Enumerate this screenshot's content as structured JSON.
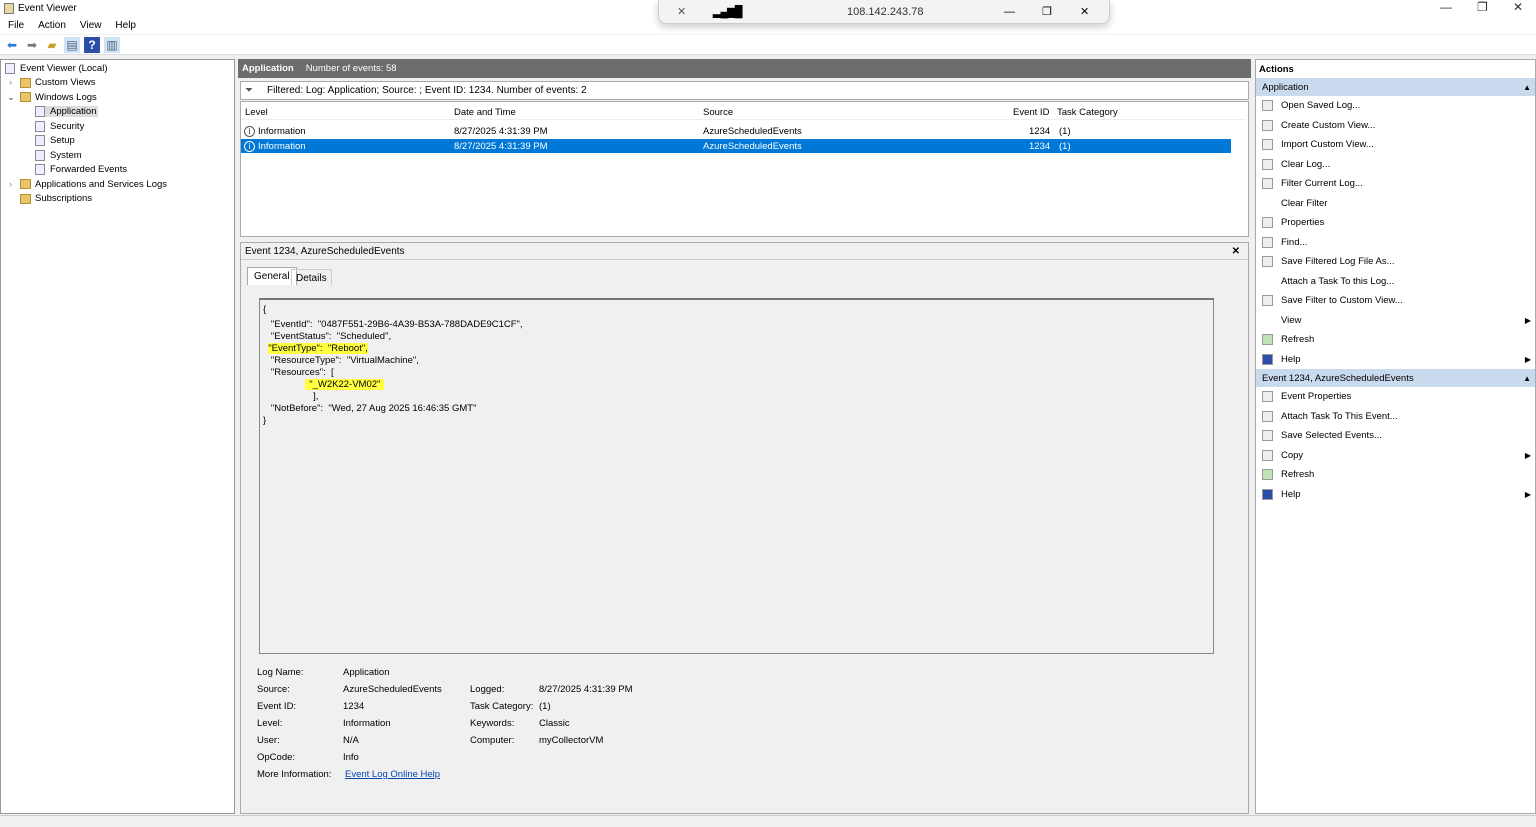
{
  "window": {
    "title": "Event Viewer",
    "minimize": "—",
    "maximize": "❐",
    "close": "✕"
  },
  "rdp": {
    "address": "108.142.243.78",
    "minimize": "—",
    "restore": "❐",
    "close": "✕"
  },
  "menu": [
    "File",
    "Action",
    "View",
    "Help"
  ],
  "tree": {
    "root": "Event Viewer (Local)",
    "custom_views": "Custom Views",
    "windows_logs": "Windows Logs",
    "logs": [
      "Application",
      "Security",
      "Setup",
      "System",
      "Forwarded Events"
    ],
    "app_services": "Applications and Services Logs",
    "subscriptions": "Subscriptions"
  },
  "center": {
    "title": "Application",
    "count": "Number of events: 58",
    "filter": "Filtered: Log: Application; Source: ; Event ID: 1234. Number of events: 2",
    "columns": [
      "Level",
      "Date and Time",
      "Source",
      "Event ID",
      "Task Category"
    ],
    "rows": [
      {
        "level": "Information",
        "date": "8/27/2025 4:31:39 PM",
        "source": "AzureScheduledEvents",
        "id": "1234",
        "task": "(1)"
      },
      {
        "level": "Information",
        "date": "8/27/2025 4:31:39 PM",
        "source": "AzureScheduledEvents",
        "id": "1234",
        "task": "(1)"
      }
    ]
  },
  "detail": {
    "title": "Event 1234, AzureScheduledEvents",
    "close": "✕",
    "tabs": [
      "General",
      "Details"
    ],
    "json": {
      "l0": "{",
      "l1": "   \"EventId\":  \"0487F551-29B6-4A39-B53A-788DADE9C1CF\",",
      "l2": "   \"EventStatus\":  \"Scheduled\",",
      "l3": "\"EventType\":  \"Reboot\",",
      "l4": "   \"ResourceType\":  \"VirtualMachine\",",
      "l5": "   \"Resources\":  [",
      "l6": "\"_W2K22-VM02\"",
      "l7": "                   ],",
      "l8": "   \"NotBefore\":  \"Wed, 27 Aug 2025 16:46:35 GMT\"",
      "l9": "}"
    },
    "props": {
      "log_name_l": "Log Name:",
      "log_name": "Application",
      "source_l": "Source:",
      "source": "AzureScheduledEvents",
      "logged_l": "Logged:",
      "logged": "8/27/2025 4:31:39 PM",
      "eventid_l": "Event ID:",
      "eventid": "1234",
      "taskcat_l": "Task Category:",
      "taskcat": "(1)",
      "level_l": "Level:",
      "level": "Information",
      "keywords_l": "Keywords:",
      "keywords": "Classic",
      "user_l": "User:",
      "user": "N/A",
      "computer_l": "Computer:",
      "computer": "myCollectorVM",
      "opcode_l": "OpCode:",
      "opcode": "Info",
      "moreinfo_l": "More Information:",
      "moreinfo": "Event Log Online Help"
    }
  },
  "actions": {
    "title": "Actions",
    "sec1": "Application",
    "items1": [
      "Open Saved Log...",
      "Create Custom View...",
      "Import Custom View...",
      "Clear Log...",
      "Filter Current Log...",
      "Clear Filter",
      "Properties",
      "Find...",
      "Save Filtered Log File As...",
      "Attach a Task To this Log...",
      "Save Filter to Custom View...",
      "View",
      "Refresh",
      "Help"
    ],
    "sec2": "Event 1234, AzureScheduledEvents",
    "items2": [
      "Event Properties",
      "Attach Task To This Event...",
      "Save Selected Events...",
      "Copy",
      "Refresh",
      "Help"
    ]
  }
}
